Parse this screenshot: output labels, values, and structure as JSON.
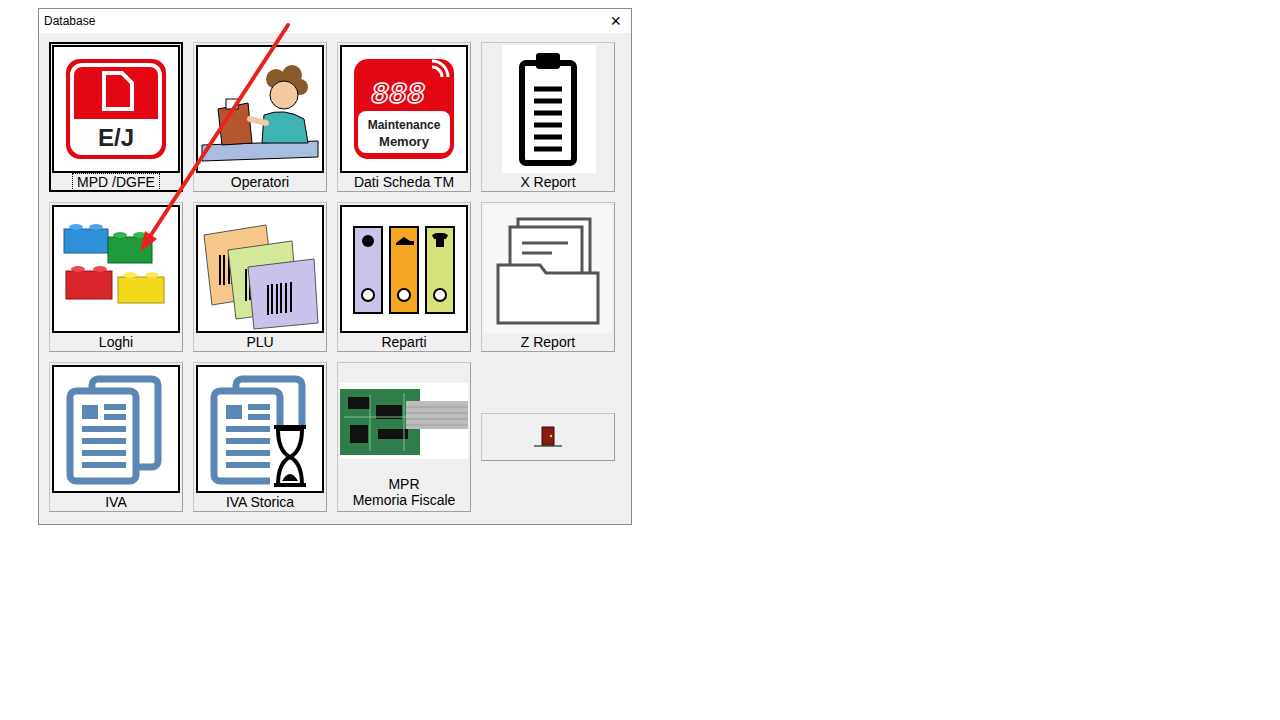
{
  "window": {
    "title": "Database",
    "close_glyph": "×"
  },
  "tiles": [
    {
      "kind": "ej",
      "label": [
        "MPD /DGFE"
      ],
      "icon_text": [
        "E/J"
      ],
      "focused": true
    },
    {
      "kind": "operator",
      "label": [
        "Operatori"
      ],
      "icon_text": [],
      "focused": false
    },
    {
      "kind": "maintenance",
      "label": [
        "Dati Scheda TM"
      ],
      "icon_text": [
        "888",
        "Maintenance",
        "Memory"
      ],
      "focused": false
    },
    {
      "kind": "xreport",
      "label": [
        "X Report"
      ],
      "icon_text": [],
      "focused": false
    },
    {
      "kind": "logos",
      "label": [
        "Loghi"
      ],
      "icon_text": [],
      "focused": false
    },
    {
      "kind": "plu",
      "label": [
        "PLU"
      ],
      "icon_text": [],
      "focused": false
    },
    {
      "kind": "departments",
      "label": [
        "Reparti"
      ],
      "icon_text": [],
      "focused": false
    },
    {
      "kind": "zreport",
      "label": [
        "Z Report"
      ],
      "icon_text": [],
      "focused": false
    },
    {
      "kind": "vat",
      "label": [
        "IVA"
      ],
      "icon_text": [],
      "focused": false
    },
    {
      "kind": "vat-history",
      "label": [
        "IVA Storica"
      ],
      "icon_text": [],
      "focused": false
    },
    {
      "kind": "board",
      "label": [
        "MPR",
        "Memoria Fiscale"
      ],
      "icon_text": [],
      "focused": false
    },
    {
      "kind": "exit",
      "label": [],
      "icon_text": [],
      "focused": false
    }
  ]
}
